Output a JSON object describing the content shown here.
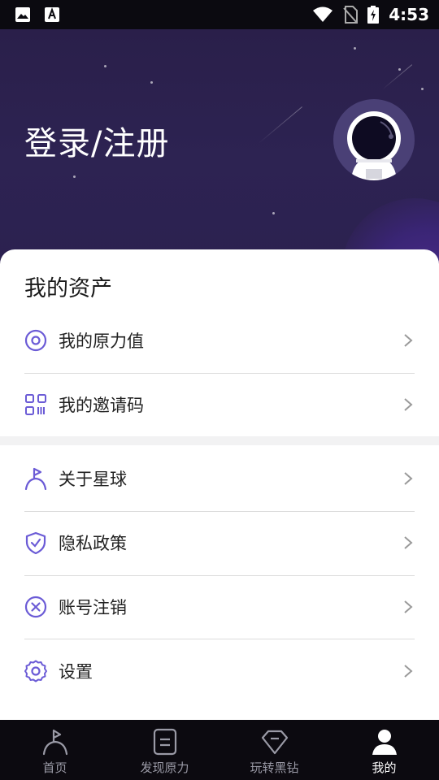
{
  "status_bar": {
    "time": "4:53"
  },
  "header": {
    "login_text": "登录/注册"
  },
  "assets": {
    "title": "我的资产",
    "items": [
      {
        "label": "我的原力值",
        "icon": "target-circle-icon"
      },
      {
        "label": "我的邀请码",
        "icon": "qr-code-icon"
      }
    ]
  },
  "menu": {
    "items": [
      {
        "label": "关于星球",
        "icon": "flag-person-icon"
      },
      {
        "label": "隐私政策",
        "icon": "shield-check-icon"
      },
      {
        "label": "账号注销",
        "icon": "close-circle-icon"
      },
      {
        "label": "设置",
        "icon": "gear-icon"
      }
    ]
  },
  "tabbar": {
    "tabs": [
      {
        "label": "首页",
        "icon": "home-flag-icon",
        "active": false
      },
      {
        "label": "发现原力",
        "icon": "document-icon",
        "active": false
      },
      {
        "label": "玩转黑钻",
        "icon": "diamond-icon",
        "active": false
      },
      {
        "label": "我的",
        "icon": "person-icon",
        "active": true
      }
    ]
  },
  "colors": {
    "accent": "#6b5bd6",
    "header_bg": "#2b204d",
    "tabbar_bg": "#0c0a10"
  }
}
